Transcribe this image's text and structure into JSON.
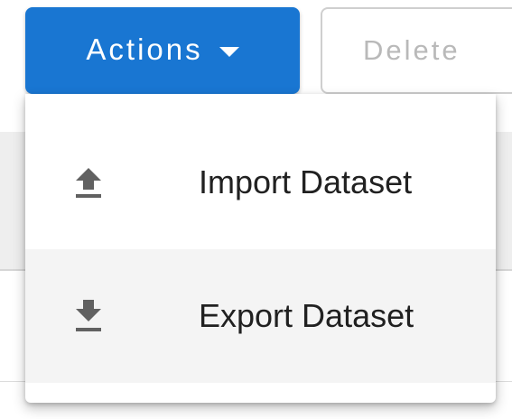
{
  "toolbar": {
    "actions_label": "Actions",
    "delete_label": "Delete"
  },
  "menu": {
    "items": [
      {
        "label": "Import Dataset",
        "icon": "upload-icon"
      },
      {
        "label": "Export Dataset",
        "icon": "download-icon"
      }
    ]
  },
  "colors": {
    "primary": "#1976d2",
    "disabled_text": "#b9b9b9",
    "menu_text": "#212121",
    "icon": "#616161",
    "hover_row": "#f4f4f4"
  }
}
